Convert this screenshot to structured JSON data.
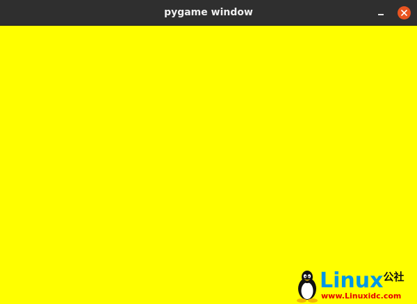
{
  "window": {
    "title": "pygame window",
    "canvas_color": "#ffff00",
    "titlebar_color": "#2f2f2f",
    "close_button_color": "#e95420"
  },
  "controls": {
    "minimize_icon": "minimize-icon",
    "close_icon": "close-icon"
  },
  "watermark": {
    "brand": "Linux",
    "brand_suffix": "公社",
    "url": "www.Linuxidc.com",
    "logo_icon": "tux-penguin-icon",
    "brand_color": "#0096e6",
    "url_color": "#e60000"
  }
}
